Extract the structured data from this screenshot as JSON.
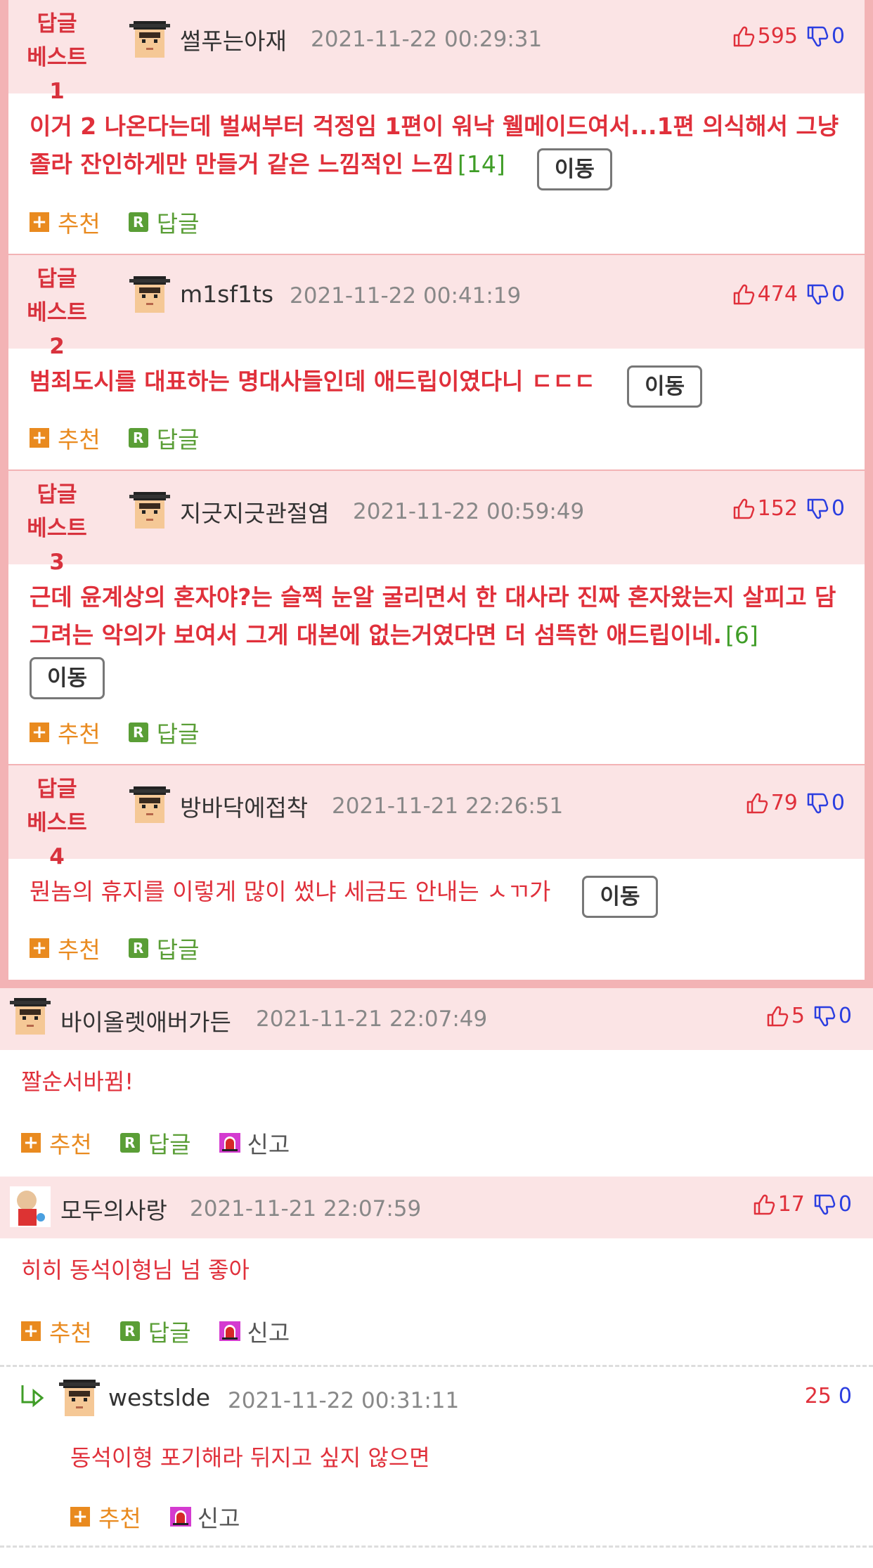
{
  "best_comments": [
    {
      "badge_line1": "답글",
      "badge_line2": "베스트1",
      "nickname": "썰푸는아재",
      "date": "2021-11-22 00:29:31",
      "up": "595",
      "down": "0",
      "text": "이거 2 나온다는데 벌써부터 걱정임 1편이 워낙 웰메이드여서...1편 의식해서 그냥 졸라 잔인하게만 만들거 같은 느낌적인 느낌",
      "reply_count": "[14]",
      "move_label": "이동",
      "recommend_label": "추천",
      "reply_label": "답글"
    },
    {
      "badge_line1": "답글",
      "badge_line2": "베스트2",
      "nickname": "m1sf1ts",
      "date": "2021-11-22 00:41:19",
      "up": "474",
      "down": "0",
      "text": "범죄도시를 대표하는 명대사들인데 애드립이였다니 ㄷㄷㄷ",
      "reply_count": "",
      "move_label": "이동",
      "recommend_label": "추천",
      "reply_label": "답글"
    },
    {
      "badge_line1": "답글",
      "badge_line2": "베스트3",
      "nickname": "지긋지긋관절염",
      "date": "2021-11-22 00:59:49",
      "up": "152",
      "down": "0",
      "text": "근데 윤계상의 혼자야?는 슬쩍 눈알 굴리면서 한 대사라 진짜 혼자왔는지 살피고 담그려는 악의가 보여서 그게 대본에 없는거였다면 더 섬뜩한 애드립이네.",
      "reply_count": "[6]",
      "move_label": "이동",
      "recommend_label": "추천",
      "reply_label": "답글"
    },
    {
      "badge_line1": "답글",
      "badge_line2": "베스트4",
      "nickname": "방바닥에접착",
      "date": "2021-11-21 22:26:51",
      "up": "79",
      "down": "0",
      "text": "뭔놈의 휴지를 이렇게 많이 썼냐 세금도 안내는 ㅅㄲ가",
      "reply_count": "",
      "move_label": "이동",
      "recommend_label": "추천",
      "reply_label": "답글"
    }
  ],
  "comments": [
    {
      "nickname": "바이올렛애버가든",
      "date": "2021-11-21 22:07:49",
      "up": "5",
      "down": "0",
      "text": "짤순서바뀜!",
      "recommend_label": "추천",
      "reply_label": "답글",
      "report_label": "신고"
    },
    {
      "nickname": "모두의사랑",
      "date": "2021-11-21 22:07:59",
      "up": "17",
      "down": "0",
      "text": "히히 동석이형님 넘 좋아",
      "recommend_label": "추천",
      "reply_label": "답글",
      "report_label": "신고"
    }
  ],
  "reply": {
    "nickname": "westslde",
    "date": "2021-11-22 00:31:11",
    "up": "25",
    "down": "0",
    "text": "동석이형 포기해라 뒤지고 싶지 않으면",
    "recommend_label": "추천",
    "report_label": "신고"
  },
  "colors": {
    "accent_red": "#e0303b",
    "down_blue": "#2b3ee0",
    "recommend_orange": "#e98a1f",
    "reply_green": "#5a9e36",
    "header_pink": "#fbe4e5",
    "border_pink": "#f3b3b5"
  }
}
